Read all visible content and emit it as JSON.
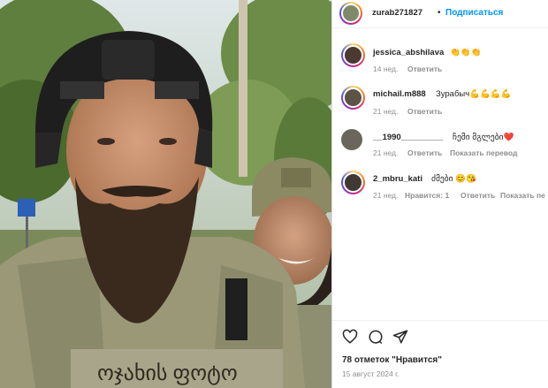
{
  "post": {
    "author": "zurab271827",
    "follow_label": "Подписаться"
  },
  "comments": [
    {
      "user": "jessica_abshilava",
      "text": "👏👏👏",
      "time": "14 нед.",
      "reply": "Ответить",
      "translate": "",
      "likes": ""
    },
    {
      "user": "michail.m888",
      "text": "Зурабыч💪💪💪💪",
      "time": "21 нед.",
      "reply": "Ответить",
      "translate": "",
      "likes": ""
    },
    {
      "user": "__1990_________",
      "text": "ჩემი მგლები❤️",
      "time": "21 нед.",
      "reply": "Ответить",
      "translate": "Показать перевод",
      "likes": ""
    },
    {
      "user": "2_mbru_kati",
      "text": "ძმები 😊😘",
      "time": "21 нед.",
      "reply": "Ответить",
      "translate": "Показать пе",
      "likes": "Нравится: 1"
    }
  ],
  "likes_text": "78 отметок \"Нравится\"",
  "date": "15 август 2024 г.",
  "photo_text": "ოჯახის ფოტო",
  "colors": {
    "accent": "#0095f6",
    "muted": "#8e8e8e"
  }
}
